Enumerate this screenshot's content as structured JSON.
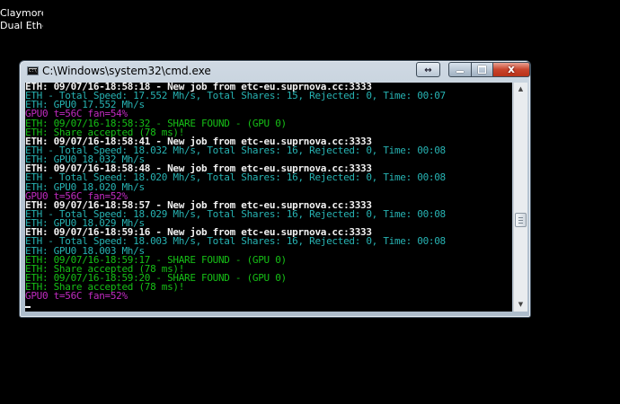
{
  "desktop": {
    "icon_label_line1": "Claymore's",
    "icon_label_line2": "Dual Ethere..."
  },
  "window": {
    "title": "C:\\Windows\\system32\\cmd.exe",
    "icons": {
      "app": "cmd-icon",
      "resize": "resize-arrows-icon",
      "minimize": "minimize-icon",
      "maximize": "maximize-icon",
      "close": "close-icon"
    },
    "close_glyph": "x",
    "resize_glyph": "↔"
  },
  "colors": {
    "white_text": "#f2f2f2",
    "cyan_text": "#27b3b3",
    "green_text": "#16c016",
    "magenta_text": "#c02bc0",
    "close_button": "#c8442c"
  },
  "console": {
    "lines": [
      {
        "text": "ETH: 09/07/16-18:58:18 - New job from etc-eu.suprnova.cc:3333",
        "color": "white"
      },
      {
        "text": "ETH - Total Speed: 17.552 Mh/s, Total Shares: 15, Rejected: 0, Time: 00:07",
        "color": "cyan"
      },
      {
        "text": "ETH: GPU0 17.552 Mh/s",
        "color": "cyan"
      },
      {
        "text": "GPU0 t=56C fan=54%",
        "color": "magenta"
      },
      {
        "text": "ETH: 09/07/16-18:58:32 - SHARE FOUND - (GPU 0)",
        "color": "green"
      },
      {
        "text": "ETH: Share accepted (78 ms)!",
        "color": "green"
      },
      {
        "text": "ETH: 09/07/16-18:58:41 - New job from etc-eu.suprnova.cc:3333",
        "color": "white"
      },
      {
        "text": "ETH - Total Speed: 18.032 Mh/s, Total Shares: 16, Rejected: 0, Time: 00:08",
        "color": "cyan"
      },
      {
        "text": "ETH: GPU0 18.032 Mh/s",
        "color": "cyan"
      },
      {
        "text": "ETH: 09/07/16-18:58:48 - New job from etc-eu.suprnova.cc:3333",
        "color": "white"
      },
      {
        "text": "ETH - Total Speed: 18.020 Mh/s, Total Shares: 16, Rejected: 0, Time: 00:08",
        "color": "cyan"
      },
      {
        "text": "ETH: GPU0 18.020 Mh/s",
        "color": "cyan"
      },
      {
        "text": "GPU0 t=56C fan=52%",
        "color": "magenta"
      },
      {
        "text": "ETH: 09/07/16-18:58:57 - New job from etc-eu.suprnova.cc:3333",
        "color": "white"
      },
      {
        "text": "ETH - Total Speed: 18.029 Mh/s, Total Shares: 16, Rejected: 0, Time: 00:08",
        "color": "cyan"
      },
      {
        "text": "ETH: GPU0 18.029 Mh/s",
        "color": "cyan"
      },
      {
        "text": "ETH: 09/07/16-18:59:16 - New job from etc-eu.suprnova.cc:3333",
        "color": "white"
      },
      {
        "text": "ETH - Total Speed: 18.003 Mh/s, Total Shares: 16, Rejected: 0, Time: 00:08",
        "color": "cyan"
      },
      {
        "text": "ETH: GPU0 18.003 Mh/s",
        "color": "cyan"
      },
      {
        "text": "ETH: 09/07/16-18:59:17 - SHARE FOUND - (GPU 0)",
        "color": "green"
      },
      {
        "text": "ETH: Share accepted (78 ms)!",
        "color": "green"
      },
      {
        "text": "ETH: 09/07/16-18:59:20 - SHARE FOUND - (GPU 0)",
        "color": "green"
      },
      {
        "text": "ETH: Share accepted (78 ms)!",
        "color": "green"
      },
      {
        "text": "GPU0 t=56C fan=52%",
        "color": "magenta"
      }
    ]
  },
  "scrollbar": {
    "position_fraction": 0.62,
    "up_arrow": "▲",
    "down_arrow": "▼"
  }
}
